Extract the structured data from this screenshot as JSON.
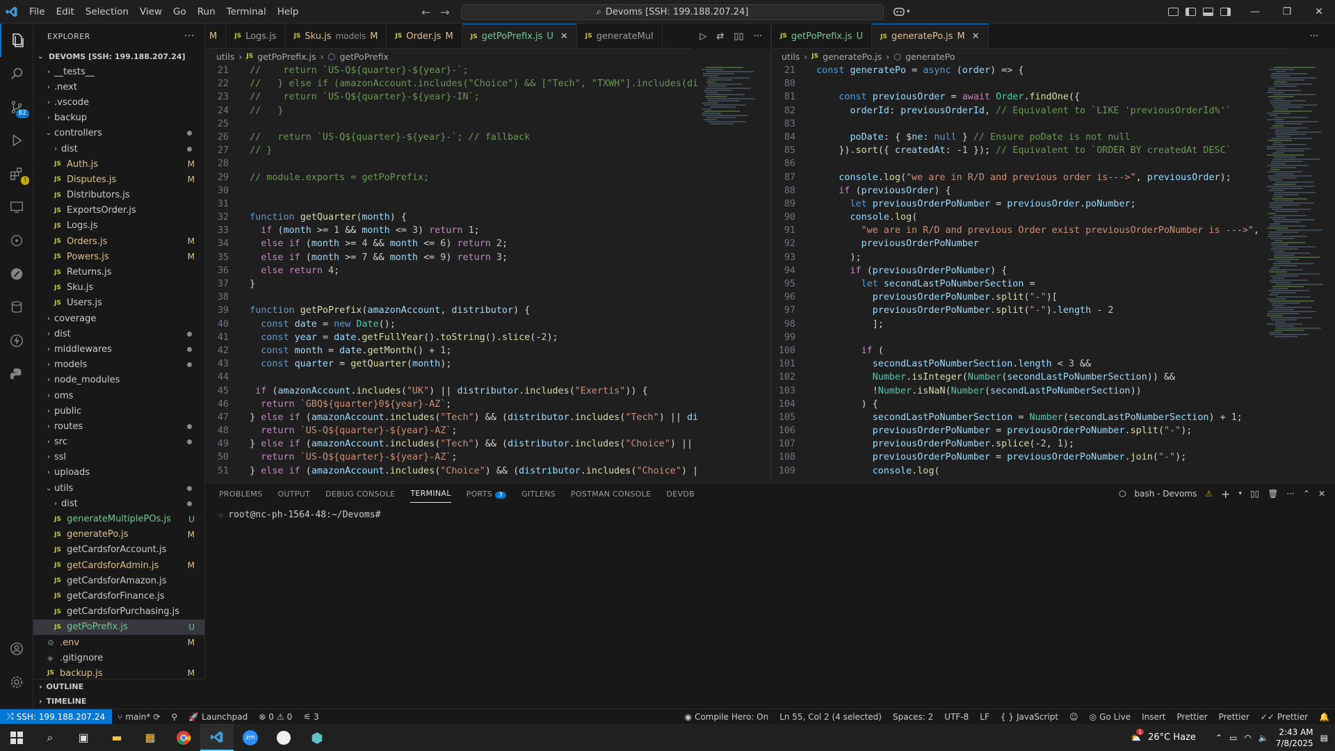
{
  "menu": [
    "File",
    "Edit",
    "Selection",
    "View",
    "Go",
    "Run",
    "Terminal",
    "Help"
  ],
  "command_center": "Devoms [SSH: 199.188.207.24]",
  "explorer": {
    "title": "EXPLORER",
    "root": "DEVOMS [SSH: 199.188.207.24]",
    "items": [
      {
        "label": "__tests__",
        "type": "folder",
        "indent": 1
      },
      {
        "label": ".next",
        "type": "folder",
        "indent": 1
      },
      {
        "label": ".vscode",
        "type": "folder",
        "indent": 1
      },
      {
        "label": "backup",
        "type": "folder",
        "indent": 1
      },
      {
        "label": "controllers",
        "type": "folder-open",
        "indent": 1,
        "dot": true
      },
      {
        "label": "dist",
        "type": "folder",
        "indent": 2,
        "dot": true
      },
      {
        "label": "Auth.js",
        "type": "js",
        "indent": 2,
        "status": "M"
      },
      {
        "label": "Disputes.js",
        "type": "js",
        "indent": 2,
        "status": "M"
      },
      {
        "label": "Distributors.js",
        "type": "js",
        "indent": 2
      },
      {
        "label": "ExportsOrder.js",
        "type": "js",
        "indent": 2
      },
      {
        "label": "Logs.js",
        "type": "js",
        "indent": 2
      },
      {
        "label": "Orders.js",
        "type": "js",
        "indent": 2,
        "status": "M"
      },
      {
        "label": "Powers.js",
        "type": "js",
        "indent": 2,
        "status": "M"
      },
      {
        "label": "Returns.js",
        "type": "js",
        "indent": 2
      },
      {
        "label": "Sku.js",
        "type": "js",
        "indent": 2
      },
      {
        "label": "Users.js",
        "type": "js",
        "indent": 2
      },
      {
        "label": "coverage",
        "type": "folder",
        "indent": 1
      },
      {
        "label": "dist",
        "type": "folder",
        "indent": 1,
        "dot": true
      },
      {
        "label": "middlewares",
        "type": "folder",
        "indent": 1,
        "dot": true
      },
      {
        "label": "models",
        "type": "folder",
        "indent": 1,
        "dot": true
      },
      {
        "label": "node_modules",
        "type": "folder",
        "indent": 1
      },
      {
        "label": "oms",
        "type": "folder",
        "indent": 1
      },
      {
        "label": "public",
        "type": "folder",
        "indent": 1
      },
      {
        "label": "routes",
        "type": "folder",
        "indent": 1,
        "dot": true
      },
      {
        "label": "src",
        "type": "folder",
        "indent": 1,
        "dot": true
      },
      {
        "label": "ssl",
        "type": "folder",
        "indent": 1
      },
      {
        "label": "uploads",
        "type": "folder",
        "indent": 1
      },
      {
        "label": "utils",
        "type": "folder-open",
        "indent": 1,
        "dot": true
      },
      {
        "label": "dist",
        "type": "folder",
        "indent": 2,
        "dot": true
      },
      {
        "label": "generateMultiplePOs.js",
        "type": "js",
        "indent": 2,
        "status": "U"
      },
      {
        "label": "generatePo.js",
        "type": "js",
        "indent": 2,
        "status": "M"
      },
      {
        "label": "getCardsforAccount.js",
        "type": "js",
        "indent": 2
      },
      {
        "label": "getCardsforAdmin.js",
        "type": "js",
        "indent": 2,
        "status": "M"
      },
      {
        "label": "getCardsforAmazon.js",
        "type": "js",
        "indent": 2
      },
      {
        "label": "getCardsforFinance.js",
        "type": "js",
        "indent": 2
      },
      {
        "label": "getCardsforPurchasing.js",
        "type": "js",
        "indent": 2
      },
      {
        "label": "getPoPrefix.js",
        "type": "js",
        "indent": 2,
        "status": "U",
        "selected": true
      },
      {
        "label": ".env",
        "type": "gear",
        "indent": 1,
        "status": "M"
      },
      {
        "label": ".gitignore",
        "type": "git",
        "indent": 1
      },
      {
        "label": "backup.js",
        "type": "js",
        "indent": 1,
        "status": "M"
      }
    ],
    "outline": "OUTLINE",
    "timeline": "TIMELINE"
  },
  "left_tabs": [
    {
      "name": "M",
      "prefix": "",
      "status": "M",
      "partial": true
    },
    {
      "name": "Logs.js",
      "status": ""
    },
    {
      "name": "Sku.js",
      "desc": "models",
      "status": "M"
    },
    {
      "name": "Order.js",
      "status": "M"
    },
    {
      "name": "getPoPrefix.js",
      "status": "U",
      "active": true
    },
    {
      "name": "generateMul",
      "status": ""
    }
  ],
  "right_tabs": [
    {
      "name": "getPoPrefix.js",
      "status": "U"
    },
    {
      "name": "generatePo.js",
      "status": "M",
      "active": true
    }
  ],
  "left_breadcrumb": [
    "utils",
    "getPoPrefix.js",
    "getPoPrefix"
  ],
  "right_breadcrumb": [
    "utils",
    "generatePo.js",
    "generatePo"
  ],
  "left_code": [
    {
      "n": "21",
      "t": "  //    return `US-Q${quarter}-${year}-`;"
    },
    {
      "n": "22",
      "t": "  //   } else if (amazonAccount.includes(\"Choice\") && [\"Tech\", \"TXWH\"].includes(dist"
    },
    {
      "n": "23",
      "t": "  //    return `US-Q${quarter}-${year}-IN`;"
    },
    {
      "n": "24",
      "t": "  //   }"
    },
    {
      "n": "25",
      "t": ""
    },
    {
      "n": "26",
      "t": "  //   return `US-Q${quarter}-${year}-`; // fallback"
    },
    {
      "n": "27",
      "t": "  // }"
    },
    {
      "n": "28",
      "t": ""
    },
    {
      "n": "29",
      "t": "  // module.exports = getPoPrefix;"
    },
    {
      "n": "30",
      "t": ""
    },
    {
      "n": "31",
      "t": ""
    },
    {
      "n": "32",
      "t": "  function getQuarter(month) {"
    },
    {
      "n": "33",
      "t": "    if (month >= 1 && month <= 3) return 1;"
    },
    {
      "n": "34",
      "t": "    else if (month >= 4 && month <= 6) return 2;"
    },
    {
      "n": "35",
      "t": "    else if (month >= 7 && month <= 9) return 3;"
    },
    {
      "n": "36",
      "t": "    else return 4;"
    },
    {
      "n": "37",
      "t": "  }"
    },
    {
      "n": "38",
      "t": ""
    },
    {
      "n": "39",
      "t": "  function getPoPrefix(amazonAccount, distributor) {"
    },
    {
      "n": "40",
      "t": "    const date = new Date();"
    },
    {
      "n": "41",
      "t": "    const year = date.getFullYear().toString().slice(-2);"
    },
    {
      "n": "42",
      "t": "    const month = date.getMonth() + 1;"
    },
    {
      "n": "43",
      "t": "    const quarter = getQuarter(month);"
    },
    {
      "n": "44",
      "t": ""
    },
    {
      "n": "45",
      "t": "   if (amazonAccount.includes(\"UK\") || distributor.includes(\"Exertis\")) {"
    },
    {
      "n": "46",
      "t": "    return `GBQ${quarter}0${year}-AZ`;"
    },
    {
      "n": "47",
      "t": "  } else if (amazonAccount.includes(\"Tech\") && (distributor.includes(\"Tech\") || dist"
    },
    {
      "n": "48",
      "t": "    return `US-Q${quarter}-${year}-AZ`;"
    },
    {
      "n": "49",
      "t": "  } else if (amazonAccount.includes(\"Tech\") && (distributor.includes(\"Choice\") || di"
    },
    {
      "n": "50",
      "t": "    return `US-Q${quarter}-${year}-AZ`;"
    },
    {
      "n": "51",
      "t": "  } else if (amazonAccount.includes(\"Choice\") && (distributor.includes(\"Choice\") || "
    }
  ],
  "right_code": [
    {
      "n": "21",
      "t": "  const generatePo = async (order) => {"
    },
    {
      "n": "80",
      "t": ""
    },
    {
      "n": "81",
      "t": "      const previousOrder = await Order.findOne({"
    },
    {
      "n": "82",
      "t": "        orderId: previousOrderId, // Equivalent to `LIKE 'previousOrderId%'`"
    },
    {
      "n": "83",
      "t": ""
    },
    {
      "n": "84",
      "t": "        poDate: { $ne: null } // Ensure poDate is not null"
    },
    {
      "n": "85",
      "t": "      }).sort({ createdAt: -1 }); // Equivalent to `ORDER BY createdAt DESC`"
    },
    {
      "n": "86",
      "t": ""
    },
    {
      "n": "87",
      "t": "      console.log(\"we are in R/D and previous order is--->\", previousOrder);"
    },
    {
      "n": "88",
      "t": "      if (previousOrder) {"
    },
    {
      "n": "89",
      "t": "        let previousOrderPoNumber = previousOrder.poNumber;"
    },
    {
      "n": "90",
      "t": "        console.log("
    },
    {
      "n": "91",
      "t": "          \"we are in R/D and previous Order exist previousOrderPoNumber is --->\","
    },
    {
      "n": "92",
      "t": "          previousOrderPoNumber"
    },
    {
      "n": "93",
      "t": "        );"
    },
    {
      "n": "94",
      "t": "        if (previousOrderPoNumber) {"
    },
    {
      "n": "95",
      "t": "          let secondLastPoNumberSection ="
    },
    {
      "n": "96",
      "t": "            previousOrderPoNumber.split(\"-\")["
    },
    {
      "n": "97",
      "t": "            previousOrderPoNumber.split(\"-\").length - 2"
    },
    {
      "n": "98",
      "t": "            ];"
    },
    {
      "n": "99",
      "t": ""
    },
    {
      "n": "100",
      "t": "          if ("
    },
    {
      "n": "101",
      "t": "            secondLastPoNumberSection.length < 3 &&"
    },
    {
      "n": "102",
      "t": "            Number.isInteger(Number(secondLastPoNumberSection)) &&"
    },
    {
      "n": "103",
      "t": "            !Number.isNaN(Number(secondLastPoNumberSection))"
    },
    {
      "n": "104",
      "t": "          ) {"
    },
    {
      "n": "105",
      "t": "            secondLastPoNumberSection = Number(secondLastPoNumberSection) + 1;"
    },
    {
      "n": "106",
      "t": "            previousOrderPoNumber = previousOrderPoNumber.split(\"-\");"
    },
    {
      "n": "107",
      "t": "            previousOrderPoNumber.splice(-2, 1);"
    },
    {
      "n": "108",
      "t": "            previousOrderPoNumber = previousOrderPoNumber.join(\"-\");"
    },
    {
      "n": "109",
      "t": "            console.log("
    }
  ],
  "panel": {
    "tabs": [
      "PROBLEMS",
      "OUTPUT",
      "DEBUG CONSOLE",
      "TERMINAL",
      "PORTS",
      "GITLENS",
      "POSTMAN CONSOLE",
      "DEVDB"
    ],
    "active": "TERMINAL",
    "ports_badge": "3",
    "terminal_name": "bash - Devoms",
    "prompt": "root@nc-ph-1564-48:~/Devoms#"
  },
  "statusbar": {
    "remote": "SSH: 199.188.207.24",
    "branch": "main*",
    "launchpad": "Launchpad",
    "errors": "0",
    "warnings": "0",
    "ports": "3",
    "compile_hero": "Compile Hero: On",
    "position": "Ln 55, Col 2 (4 selected)",
    "spaces": "Spaces: 2",
    "encoding": "UTF-8",
    "eol": "LF",
    "language": "JavaScript",
    "golive": "Go Live",
    "insert": "Insert",
    "prettier1": "Prettier",
    "prettier2": "Prettier",
    "prettier3": "Prettier"
  },
  "activity_badges": {
    "scm": "82"
  },
  "taskbar": {
    "weather": "26°C  Haze",
    "time": "2:43 AM",
    "date": "7/8/2025",
    "notif": "1"
  },
  "colors": {
    "accent": "#0078d4",
    "modified": "#e2c08d",
    "untracked": "#73c991"
  }
}
